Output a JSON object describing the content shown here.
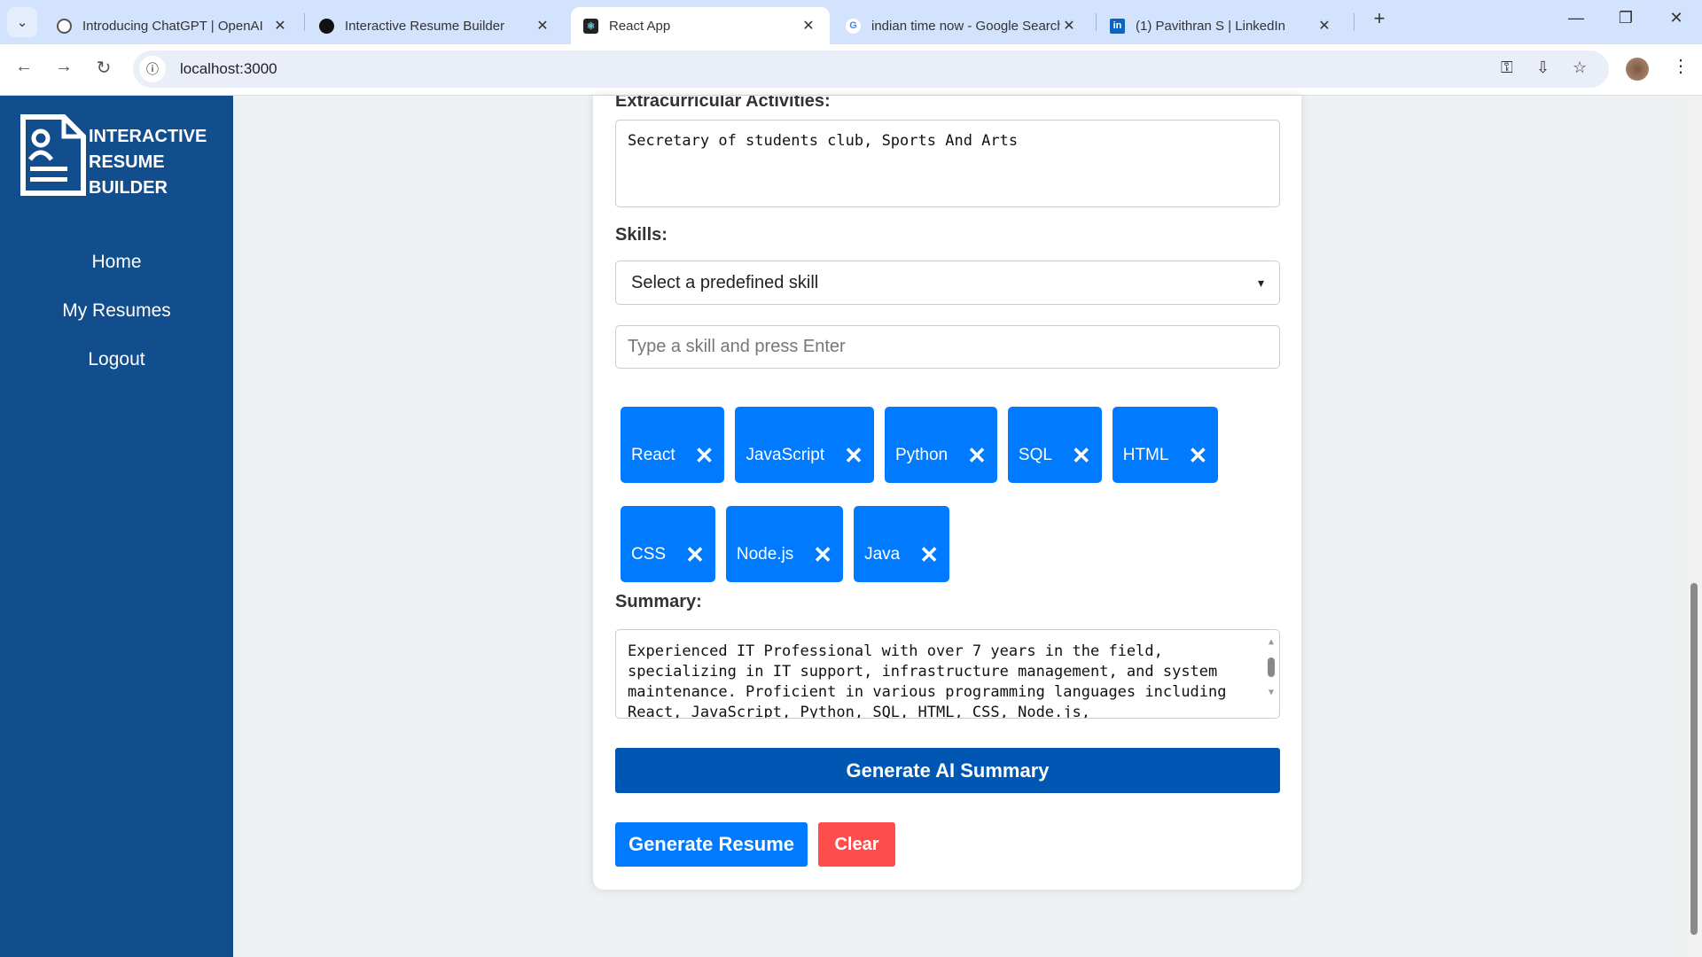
{
  "browser": {
    "tabs": [
      {
        "title": "Introducing ChatGPT | OpenAI",
        "icon": "openai-icon"
      },
      {
        "title": "Interactive Resume Builder",
        "icon": "openai-icon"
      },
      {
        "title": "React App",
        "icon": "react-icon",
        "active": true
      },
      {
        "title": "indian time now - Google Search",
        "icon": "google-icon"
      },
      {
        "title": "(1) Pavithran S | LinkedIn",
        "icon": "linkedin-icon"
      }
    ],
    "url": "localhost:3000"
  },
  "sidebar": {
    "logo_lines": [
      "INTERACTIVE",
      "RESUME",
      "BUILDER"
    ],
    "items": [
      {
        "label": "Home"
      },
      {
        "label": "My Resumes"
      },
      {
        "label": "Logout"
      }
    ]
  },
  "form": {
    "extracurricular_label": "Extracurricular Activities:",
    "extracurricular_value": "Secretary of students club, Sports And Arts",
    "skills_label": "Skills:",
    "skill_select": "Select a predefined skill",
    "skill_input_placeholder": "Type a skill and press Enter",
    "skills": [
      "React",
      "JavaScript",
      "Python",
      "SQL",
      "HTML",
      "CSS",
      "Node.js",
      "Java"
    ],
    "summary_label": "Summary:",
    "summary_value": " Experienced IT Professional with over 7 years in the field, specializing in IT support, infrastructure management, and system maintenance. Proficient in various programming languages including React, JavaScript, Python, SQL, HTML, CSS, Node.js,",
    "ai_button": "Generate AI Summary",
    "generate_button": "Generate Resume",
    "clear_button": "Clear"
  },
  "colors": {
    "sidebar": "#124e8d",
    "tag": "#007bff",
    "ai_button": "#0056b3",
    "generate": "#007bff",
    "clear": "#ff4d4d"
  }
}
